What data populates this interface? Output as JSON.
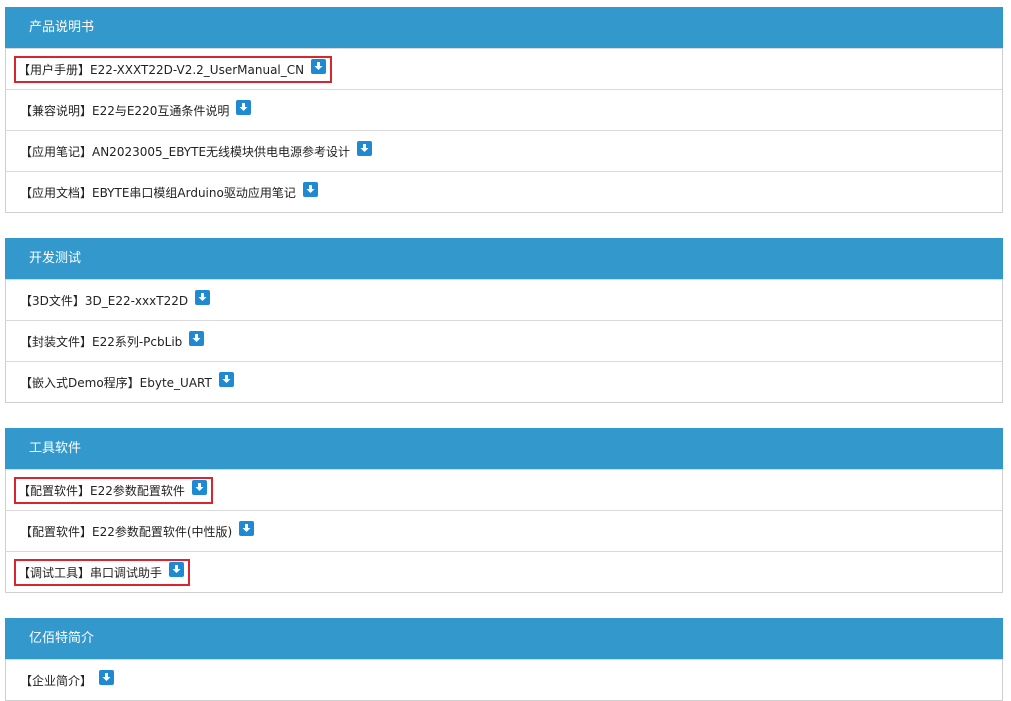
{
  "sections": [
    {
      "title": "产品说明书",
      "rows": [
        {
          "text": "【用户手册】E22-XXXT22D-V2.2_UserManual_CN",
          "highlighted": true
        },
        {
          "text": "【兼容说明】E22与E220互通条件说明",
          "highlighted": false
        },
        {
          "text": "【应用笔记】AN2023005_EBYTE无线模块供电电源参考设计",
          "highlighted": false
        },
        {
          "text": "【应用文档】EBYTE串口模组Arduino驱动应用笔记",
          "highlighted": false
        }
      ]
    },
    {
      "title": "开发测试",
      "rows": [
        {
          "text": "【3D文件】3D_E22-xxxT22D",
          "highlighted": false
        },
        {
          "text": "【封装文件】E22系列-PcbLib",
          "highlighted": false
        },
        {
          "text": "【嵌入式Demo程序】Ebyte_UART",
          "highlighted": false
        }
      ]
    },
    {
      "title": "工具软件",
      "rows": [
        {
          "text": "【配置软件】E22参数配置软件",
          "highlighted": true
        },
        {
          "text": "【配置软件】E22参数配置软件(中性版)",
          "highlighted": false
        },
        {
          "text": "【调试工具】串口调试助手",
          "highlighted": true
        }
      ]
    },
    {
      "title": "亿佰特简介",
      "rows": [
        {
          "text": "【企业简介】",
          "highlighted": false
        }
      ]
    }
  ],
  "colors": {
    "header_bg": "#3399cc",
    "download_icon": "#1f8ad1",
    "highlight_box": "#d9262e"
  },
  "icons": {
    "download": "download-arrow-icon"
  }
}
